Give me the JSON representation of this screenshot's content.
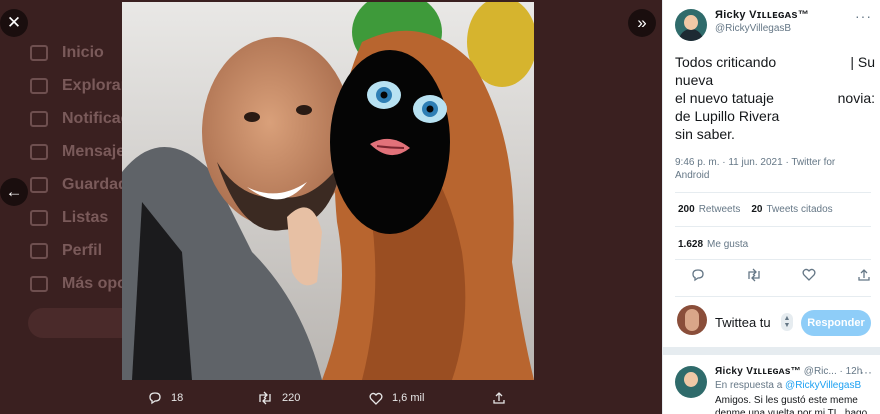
{
  "background_nav": [
    "Inicio",
    "Explorar",
    "Notificaciones",
    "Mensajes",
    "Guardados",
    "Listas",
    "Perfil",
    "Más opciones"
  ],
  "media": {
    "replies": "18",
    "retweets": "220",
    "likes": "1,6 mil"
  },
  "tweet": {
    "author_name": "Яicky Vɪʟʟᴇɢᴀs™",
    "author_handle": "@RickyVillegasB",
    "text_rows": [
      [
        "Todos criticando",
        "|  Su"
      ],
      [
        "nueva",
        ""
      ],
      [
        "el nuevo tatuaje",
        "novia:"
      ],
      [
        "de Lupillo Rivera",
        ""
      ],
      [
        "sin saber.",
        ""
      ]
    ],
    "timestamp": "9:46 p. m. · 11 jun. 2021 · Twitter for Android",
    "retweets_count": "200",
    "retweets_label": "Retweets",
    "quotes_count": "20",
    "quotes_label": "Tweets citados",
    "likes_count": "1.628",
    "likes_label": "Me gusta"
  },
  "reply_box": {
    "placeholder": "Twittea tu",
    "button_label": "Responder"
  },
  "reply": {
    "author_name": "Яicky Vɪʟʟᴇɢᴀs™",
    "author_handle": "@Ric...",
    "time": "· 12h",
    "in_reply_prefix": "En respuesta a",
    "in_reply_handle": "@RickyVillegasB",
    "text": "Amigos. Si les gustó este meme denme una vuelta por mi TL, hago"
  }
}
